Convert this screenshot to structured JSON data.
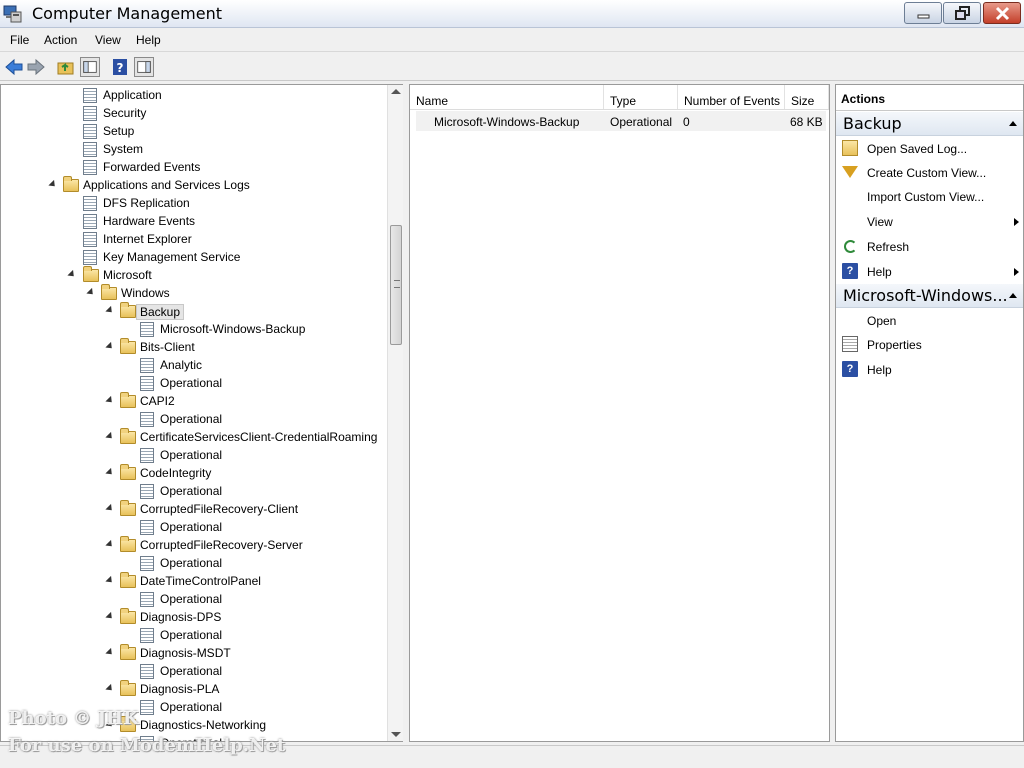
{
  "window": {
    "title": "Computer Management"
  },
  "menu": [
    "File",
    "Action",
    "View",
    "Help"
  ],
  "toolbar": {
    "icons": [
      "back-icon",
      "forward-icon",
      "up-folder-icon",
      "show-hide-tree-icon",
      "help-icon",
      "show-hide-action-pane-icon"
    ]
  },
  "tree": {
    "items": [
      {
        "label": "Application",
        "icon": "log-icon"
      },
      {
        "label": "Security",
        "icon": "log-icon"
      },
      {
        "label": "Setup",
        "icon": "log-icon"
      },
      {
        "label": "System",
        "icon": "log-icon"
      },
      {
        "label": "Forwarded Events",
        "icon": "log-icon"
      },
      {
        "label": "Applications and Services Logs",
        "icon": "folder-icon"
      },
      {
        "label": "DFS Replication",
        "icon": "log-icon"
      },
      {
        "label": "Hardware Events",
        "icon": "log-icon"
      },
      {
        "label": "Internet Explorer",
        "icon": "log-icon"
      },
      {
        "label": "Key Management Service",
        "icon": "log-icon"
      },
      {
        "label": "Microsoft",
        "icon": "folder-icon"
      },
      {
        "label": "Windows",
        "icon": "folder-icon"
      },
      {
        "label": "Backup",
        "icon": "folder-icon",
        "selected": true
      },
      {
        "label": "Microsoft-Windows-Backup",
        "icon": "log-icon"
      },
      {
        "label": "Bits-Client",
        "icon": "folder-icon"
      },
      {
        "label": "Analytic",
        "icon": "log-icon"
      },
      {
        "label": "Operational",
        "icon": "log-icon"
      },
      {
        "label": "CAPI2",
        "icon": "folder-icon"
      },
      {
        "label": "Operational",
        "icon": "log-icon"
      },
      {
        "label": "CertificateServicesClient-CredentialRoaming",
        "icon": "folder-icon"
      },
      {
        "label": "Operational",
        "icon": "log-icon"
      },
      {
        "label": "CodeIntegrity",
        "icon": "folder-icon"
      },
      {
        "label": "Operational",
        "icon": "log-icon"
      },
      {
        "label": "CorruptedFileRecovery-Client",
        "icon": "folder-icon"
      },
      {
        "label": "Operational",
        "icon": "log-icon"
      },
      {
        "label": "CorruptedFileRecovery-Server",
        "icon": "folder-icon"
      },
      {
        "label": "Operational",
        "icon": "log-icon"
      },
      {
        "label": "DateTimeControlPanel",
        "icon": "folder-icon"
      },
      {
        "label": "Operational",
        "icon": "log-icon"
      },
      {
        "label": "Diagnosis-DPS",
        "icon": "folder-icon"
      },
      {
        "label": "Operational",
        "icon": "log-icon"
      },
      {
        "label": "Diagnosis-MSDT",
        "icon": "folder-icon"
      },
      {
        "label": "Operational",
        "icon": "log-icon"
      },
      {
        "label": "Diagnosis-PLA",
        "icon": "folder-icon"
      },
      {
        "label": "Operational",
        "icon": "log-icon"
      },
      {
        "label": "Diagnostics-Networking",
        "icon": "folder-icon"
      },
      {
        "label": "Operational",
        "icon": "log-icon"
      }
    ]
  },
  "list": {
    "columns": [
      "Name",
      "Type",
      "Number of Events",
      "Size"
    ],
    "rows": [
      {
        "name": "Microsoft-Windows-Backup",
        "type": "Operational",
        "events": "0",
        "size": "68 KB"
      }
    ]
  },
  "actions": {
    "header": "Actions",
    "section1": {
      "title": "Backup",
      "items": [
        "Open Saved Log...",
        "Create Custom View...",
        "Import Custom View...",
        "View",
        "Refresh",
        "Help"
      ]
    },
    "section2": {
      "title": "Microsoft-Windows...",
      "items": [
        "Open",
        "Properties",
        "Help"
      ]
    }
  },
  "watermark": {
    "line1": "Photo © JHK",
    "line2": "For use on ModemHelp.Net"
  }
}
